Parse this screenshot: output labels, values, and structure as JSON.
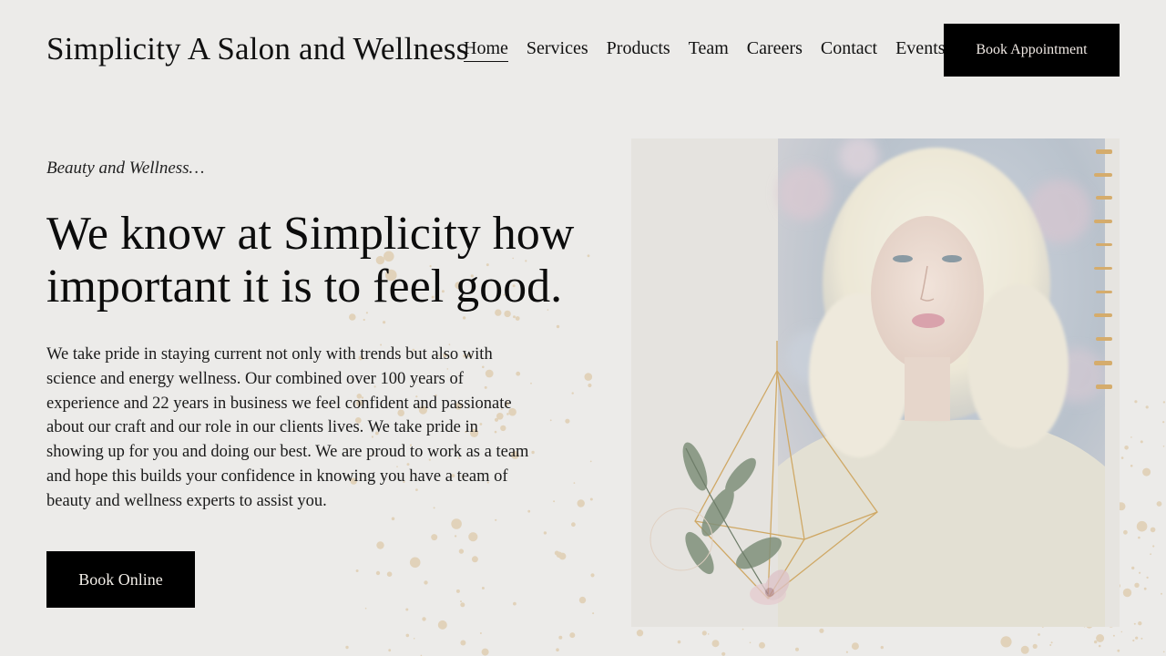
{
  "header": {
    "site_title": "Simplicity A Salon and Wellness",
    "nav": [
      {
        "label": "Home",
        "active": true
      },
      {
        "label": "Services",
        "active": false
      },
      {
        "label": "Products",
        "active": false
      },
      {
        "label": "Team",
        "active": false
      },
      {
        "label": "Careers",
        "active": false
      },
      {
        "label": "Contact",
        "active": false
      },
      {
        "label": "Events",
        "active": false
      }
    ],
    "cta_label": "Book Appointment"
  },
  "hero": {
    "eyebrow": "Beauty and Wellness…",
    "headline": "We know at Simplicity how important it is to feel good.",
    "body": "We take pride in staying current not only with trends but also with science and energy wellness.  Our combined over 100 years of experience and 22 years in business we feel confident and passionate about our craft and our role in our clients lives. We take pride in showing up for you and doing our best. We are proud to work as a team and hope this builds your confidence in knowing you have a team of beauty and wellness experts to assist you.",
    "cta_label": "Book Online"
  },
  "colors": {
    "background": "#ecebe9",
    "button": "#000000",
    "accent_gold": "#d4b07a"
  }
}
